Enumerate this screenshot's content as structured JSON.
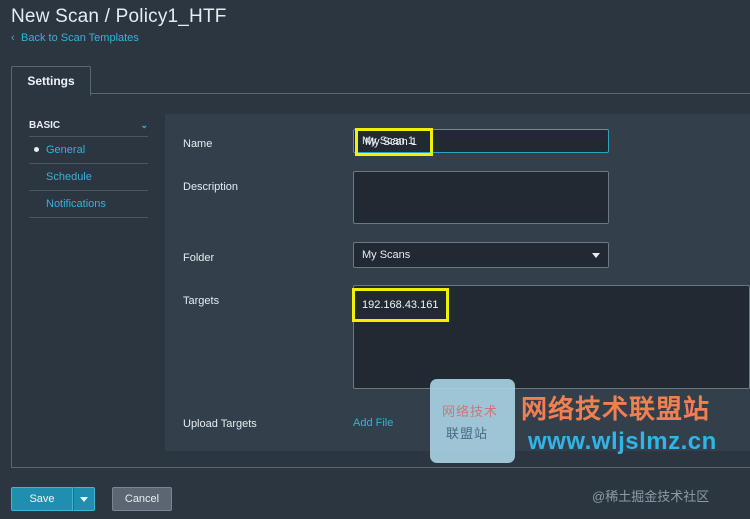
{
  "header": {
    "title": "New Scan / Policy1_HTF",
    "back_link": "Back to Scan Templates"
  },
  "tabs": [
    {
      "label": "Settings"
    }
  ],
  "sidebar": {
    "section": "BASIC",
    "items": [
      {
        "label": "General",
        "active": true
      },
      {
        "label": "Schedule"
      },
      {
        "label": "Notifications"
      }
    ]
  },
  "form": {
    "name_label": "Name",
    "name_value": "My Scan 1",
    "description_label": "Description",
    "description_value": "",
    "folder_label": "Folder",
    "folder_value": "My Scans",
    "targets_label": "Targets",
    "targets_value": "192.168.43.161",
    "upload_label": "Upload Targets",
    "add_file": "Add File"
  },
  "footer": {
    "save": "Save",
    "cancel": "Cancel"
  },
  "watermark": {
    "logo_line1": "网络技术",
    "logo_line2": "联盟站",
    "cn_text": "网络技术联盟站",
    "url": "www.wljslmz.cn",
    "juejin": "@稀土掘金技术社区"
  },
  "colors": {
    "background": "#2b3641",
    "accent": "#36b3d7",
    "highlight": "#f4f000",
    "primary_button": "#1f8fb0"
  }
}
